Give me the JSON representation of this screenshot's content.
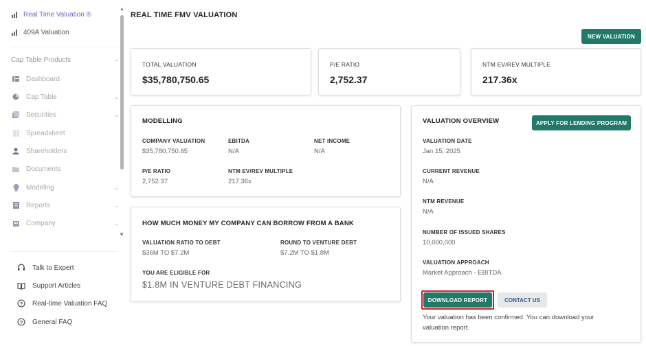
{
  "sidebar": {
    "top_items": [
      {
        "label": "Real Time Valuation ®",
        "icon": "bar-chart-icon",
        "active": true
      },
      {
        "label": "409A Valuation",
        "icon": "bar-chart-icon",
        "active": false
      }
    ],
    "section_label": "Cap Table Products",
    "sub_items": [
      {
        "label": "Dashboard",
        "icon": "dashboard-icon"
      },
      {
        "label": "Cap Table",
        "icon": "pie-chart-icon"
      },
      {
        "label": "Securities",
        "icon": "securities-icon"
      },
      {
        "label": "Spreadsheet",
        "icon": "spreadsheet-icon"
      },
      {
        "label": "Shareholders",
        "icon": "user-icon"
      },
      {
        "label": "Documents",
        "icon": "documents-icon"
      },
      {
        "label": "Modeling",
        "icon": "bulb-icon"
      },
      {
        "label": "Reports",
        "icon": "reports-icon"
      },
      {
        "label": "Company",
        "icon": "company-icon"
      }
    ],
    "footer_items": [
      {
        "label": "Talk to Expert",
        "icon": "headset-icon"
      },
      {
        "label": "Support Articles",
        "icon": "book-icon"
      },
      {
        "label": "Real-time Valuation FAQ",
        "icon": "help-icon"
      },
      {
        "label": "General FAQ",
        "icon": "help-icon"
      }
    ]
  },
  "header": {
    "title": "REAL TIME FMV VALUATION",
    "new_valuation_label": "NEW VALUATION"
  },
  "stats": [
    {
      "label": "TOTAL VALUATION",
      "value": "$35,780,750.65"
    },
    {
      "label": "P/E RATIO",
      "value": "2,752.37"
    },
    {
      "label": "NTM EV/REV MULTIPLE",
      "value": "217.36x"
    }
  ],
  "modelling": {
    "title": "MODELLING",
    "fields": [
      {
        "label": "COMPANY VALUATION",
        "value": "$35,780,750.65"
      },
      {
        "label": "EBITDA",
        "value": "N/A"
      },
      {
        "label": "NET INCOME",
        "value": "N/A"
      },
      {
        "label": "P/E RATIO",
        "value": "2,752.37"
      },
      {
        "label": "NTM EV/REV MULTIPLE",
        "value": "217.36x"
      }
    ]
  },
  "borrow": {
    "title": "HOW MUCH MONEY MY COMPANY CAN BORROW FROM A BANK",
    "ratio_label": "VALUATION RATIO TO DEBT",
    "ratio_value": "$36M TO $7.2M",
    "round_label": "ROUND TO VENTURE DEBT",
    "round_value": "$7.2M TO $1.8M",
    "eligible_label": "YOU ARE ELIGIBLE FOR",
    "eligible_value": "$1.8M IN VENTURE DEBT FINANCING"
  },
  "overview": {
    "title": "VALUATION OVERVIEW",
    "apply_label": "APPLY FOR LENDING PROGRAM",
    "fields": [
      {
        "label": "VALUATION DATE",
        "value": "Jan 15, 2025"
      },
      {
        "label": "CURRENT REVENUE",
        "value": "N/A"
      },
      {
        "label": "NTM REVENUE",
        "value": "N/A"
      },
      {
        "label": "NUMBER OF ISSUED SHARES",
        "value": "10,000,000"
      },
      {
        "label": "VALUATION APPROACH",
        "value": "Market Approach - EBITDA"
      }
    ],
    "download_label": "DOWNLOAD REPORT",
    "contact_label": "CONTACT US",
    "note": "Your valuation has been confirmed. You can download your valuation report."
  },
  "colors": {
    "accent": "#217a69",
    "active_nav": "#7b5cc9",
    "highlight": "#d0202e"
  }
}
